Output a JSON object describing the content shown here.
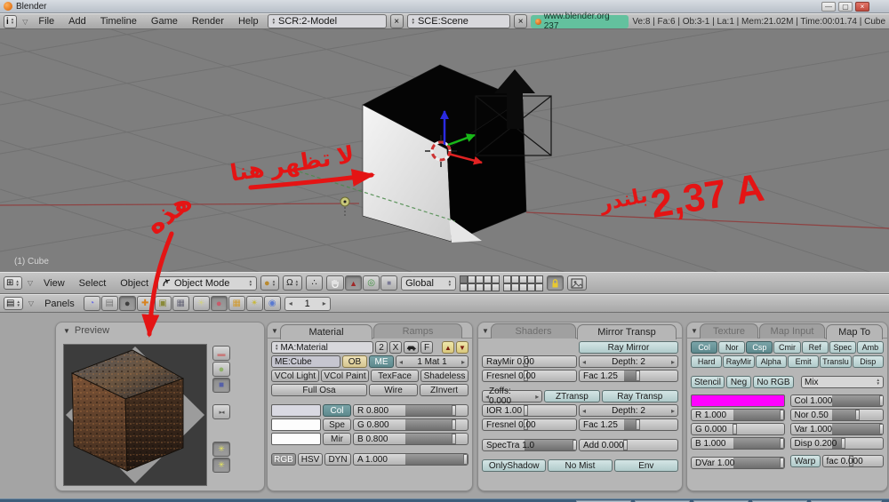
{
  "window": {
    "title": "Blender"
  },
  "colors": {
    "annotation": "#e41414",
    "link_bg": "#63c19e"
  },
  "icons": {
    "spinner_up": "▲",
    "spinner_down": "▼",
    "collapse": "▽",
    "close_x": "×",
    "minimize": "—",
    "restore": "▢",
    "info_i": "i",
    "grid_window": "⊞",
    "buttons_window": "▤",
    "left": "◂",
    "right": "▸",
    "panel_arrow": "▼",
    "draw_mode_sphere": "●",
    "pivot_omega": "Ω",
    "prop_edit": "∴",
    "manip_move": "▲",
    "manip_rotate": "◎",
    "manip_scale": "■",
    "logic": "◔",
    "script": "▤",
    "shading": "●",
    "object": "✚",
    "editing": "▣",
    "scene": "▦",
    "lamp": "☀",
    "material": "●",
    "texture": "▦",
    "radiosity": "✴",
    "world": "◉",
    "prev_flat": "▬",
    "prev_sphere": "●",
    "prev_cube": "■",
    "prev_bowtie": "▸◂",
    "prev_spark": "✳",
    "up_arrow": "▲",
    "down_arrow": "▼"
  },
  "menubar": {
    "menus": [
      "File",
      "Add",
      "Timeline",
      "Game",
      "Render",
      "Help"
    ],
    "screen": "SCR:2-Model",
    "scene": "SCE:Scene",
    "site_link": "www.blender.org 237",
    "stats": "Ve:8 | Fa:6 | Ob:3-1 | La:1 | Mem:21.02M | Time:00:01.74 | Cube"
  },
  "viewport": {
    "object_label": "(1) Cube",
    "annotations": {
      "not_shown_here": "لا تظهر هنا",
      "this_one": "هذه",
      "blender_word": "بلندر",
      "version_text": "2,37 A"
    }
  },
  "viewport_header": {
    "menus": [
      "View",
      "Select",
      "Object"
    ],
    "mode": "Object Mode",
    "orientation": "Global"
  },
  "buttons_header": {
    "panels_label": "Panels",
    "frame": "1"
  },
  "preview_panel": {
    "title": "Preview"
  },
  "material_panel": {
    "tabs": [
      "Material",
      "Ramps"
    ],
    "datablock": {
      "name": "MA:Material",
      "users": "2",
      "delete": "X",
      "fake": "F"
    },
    "mesh": "ME:Cube",
    "ob": "OB",
    "me": "ME",
    "mat_index": "1 Mat 1",
    "toggles_row1": [
      "VCol Light",
      "VCol Paint",
      "TexFace",
      "Shadeless"
    ],
    "toggles_row2": [
      "Full Osa",
      "Wire",
      "ZInvert"
    ],
    "channels": [
      "Col",
      "Spe",
      "Mir"
    ],
    "swatches": [
      "#d9d9e2",
      "#fdfdfd",
      "#fdfdfd"
    ],
    "sliders": [
      {
        "label": "R 0.800",
        "fill": 0.8
      },
      {
        "label": "G 0.800",
        "fill": 0.8
      },
      {
        "label": "B 0.800",
        "fill": 0.8
      },
      {
        "label": "A 1.000",
        "fill": 1
      }
    ],
    "color_modes": [
      "RGB",
      "HSV",
      "DYN"
    ]
  },
  "shaders_panel": {
    "tabs": [
      "Shaders",
      "Mirror Transp"
    ],
    "ray_mirror": "Ray Mirror",
    "raymir": {
      "label": "RayMir 0.00",
      "fill": 0
    },
    "depth1": "Depth: 2",
    "fresnel1": {
      "label": "Fresnel 0.00",
      "fill": 0
    },
    "fac1": {
      "label": "Fac 1.25",
      "fill": 0.25
    },
    "zoffs": "Zoffs: 0.000",
    "ztransp": "ZTransp",
    "ray_transp": "Ray Transp",
    "ior": {
      "label": "IOR 1.00",
      "fill": 0
    },
    "depth2": "Depth: 2",
    "fresnel2": {
      "label": "Fresnel 0.00",
      "fill": 0
    },
    "fac2": {
      "label": "Fac 1.25",
      "fill": 0.25
    },
    "spectra": {
      "label": "SpecTra 1.0",
      "fill": 1
    },
    "add": {
      "label": "Add 0.000",
      "fill": 0
    },
    "bottom": [
      "OnlyShadow",
      "No Mist",
      "Env"
    ]
  },
  "mapto_panel": {
    "tabs": [
      "Texture",
      "Map Input",
      "Map To"
    ],
    "row1": [
      "Col",
      "Nor",
      "Csp",
      "Cmir",
      "Ref",
      "Spec",
      "Amb"
    ],
    "row2": [
      "Hard",
      "RayMir",
      "Alpha",
      "Emit",
      "Translu",
      "Disp"
    ],
    "row3": [
      "Stencil",
      "Neg",
      "No RGB"
    ],
    "blend_mode": "Mix",
    "swatch_color": "#ff00ff",
    "left_sliders": [
      {
        "label": "R 1.000",
        "fill": 1
      },
      {
        "label": "G 0.000",
        "fill": 0
      },
      {
        "label": "B 1.000",
        "fill": 1
      }
    ],
    "dvar": {
      "label": "DVar 1.00",
      "fill": 1
    },
    "right_sliders": [
      {
        "label": "Col 1.000",
        "fill": 1
      },
      {
        "label": "Nor 0.50",
        "fill": 0.5
      },
      {
        "label": "Var 1.000",
        "fill": 1
      },
      {
        "label": "Disp 0.200",
        "fill": 0.2
      }
    ],
    "warp": "Warp",
    "fac": {
      "label": "fac 0.000",
      "fill": 0
    }
  }
}
